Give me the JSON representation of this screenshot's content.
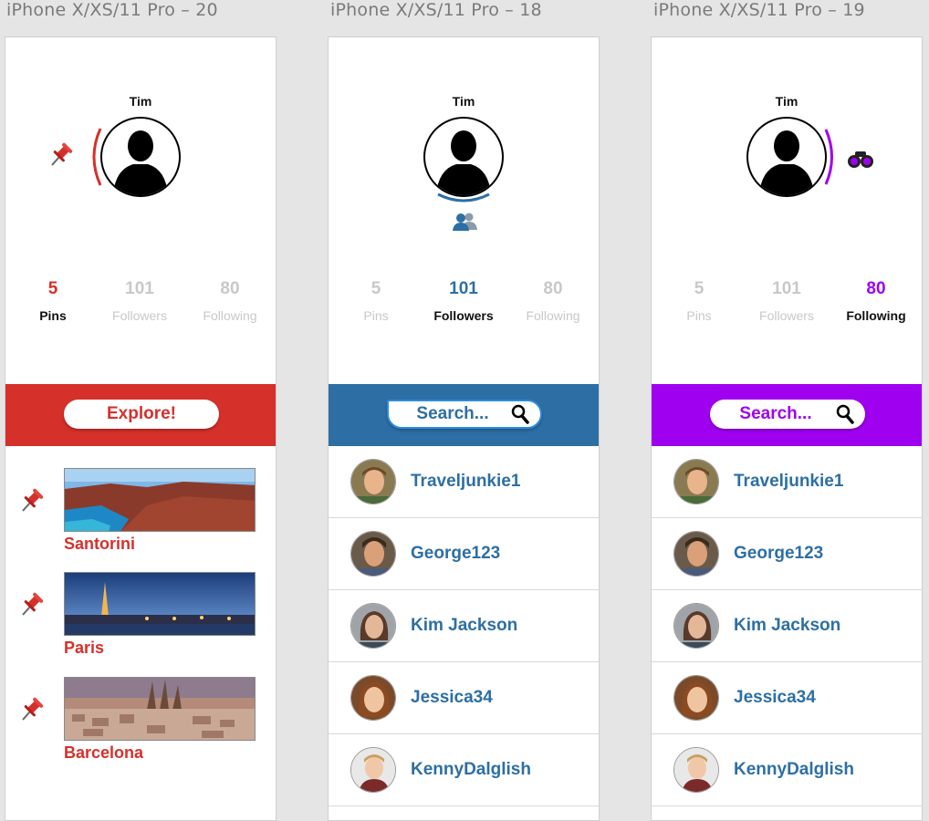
{
  "artboards": [
    {
      "label": "iPhone X/XS/11 Pro – 20",
      "user_name": "Tim",
      "accent": "#d6302b",
      "stats": [
        {
          "value": "5",
          "label": "Pins"
        },
        {
          "value": "101",
          "label": "Followers"
        },
        {
          "value": "80",
          "label": "Following"
        }
      ],
      "active_stat": "Pins",
      "button_label": "Explore!",
      "places": [
        {
          "name": "Santorini",
          "icon": "pushpin-icon"
        },
        {
          "name": "Paris",
          "icon": "pushpin-icon"
        },
        {
          "name": "Barcelona",
          "icon": "pushpin-icon"
        }
      ]
    },
    {
      "label": "iPhone X/XS/11 Pro – 18",
      "user_name": "Tim",
      "accent": "#2d6fa5",
      "stats": [
        {
          "value": "5",
          "label": "Pins"
        },
        {
          "value": "101",
          "label": "Followers"
        },
        {
          "value": "80",
          "label": "Following"
        }
      ],
      "active_stat": "Followers",
      "search_label": "Search...",
      "users": [
        {
          "name": "Traveljunkie1"
        },
        {
          "name": "George123"
        },
        {
          "name": "Kim Jackson"
        },
        {
          "name": "Jessica34"
        },
        {
          "name": "KennyDalglish"
        }
      ]
    },
    {
      "label": "iPhone X/XS/11 Pro – 19",
      "user_name": "Tim",
      "accent": "#a000f0",
      "stats": [
        {
          "value": "5",
          "label": "Pins"
        },
        {
          "value": "101",
          "label": "Followers"
        },
        {
          "value": "80",
          "label": "Following"
        }
      ],
      "active_stat": "Following",
      "search_label": "Search...",
      "users": [
        {
          "name": "Traveljunkie1"
        },
        {
          "name": "George123"
        },
        {
          "name": "Kim Jackson"
        },
        {
          "name": "Jessica34"
        },
        {
          "name": "KennyDalglish"
        }
      ]
    }
  ]
}
